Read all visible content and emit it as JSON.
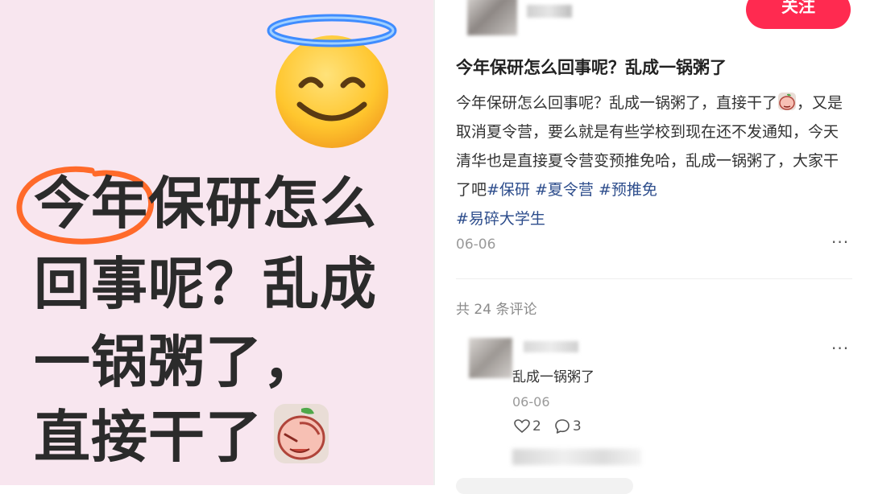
{
  "cover": {
    "lines": [
      "今年保研怎么",
      "回事呢？乱成",
      "一锅粥了，",
      "直接干了"
    ],
    "background": "#f8e6ef",
    "highlight_color": "#ff6a2a",
    "icons": [
      "halo-smile-emoji",
      "peach-facepalm-emoji"
    ]
  },
  "author": {
    "follow_label": "关注",
    "follow_color": "#ff2a50"
  },
  "post": {
    "title": "今年保研怎么回事呢？乱成一锅粥了",
    "body_part1": "今年保研怎么回事呢？乱成一锅粥了，直接干了",
    "body_part2": "，又是取消夏令营，要么就是有些学校到现在还不发通知，今天清华也是直接夏令营变预推免哈，乱成一锅粥了，大家干了吧",
    "tags": [
      "#保研",
      "#夏令营",
      "#预推免",
      "#易碎大学生"
    ],
    "date": "06-06",
    "more": "···"
  },
  "comments": {
    "count_text": "共 24 条评论",
    "items": [
      {
        "text": "乱成一锅粥了",
        "date": "06-06",
        "likes": "2",
        "replies": "3",
        "more": "···"
      }
    ]
  }
}
